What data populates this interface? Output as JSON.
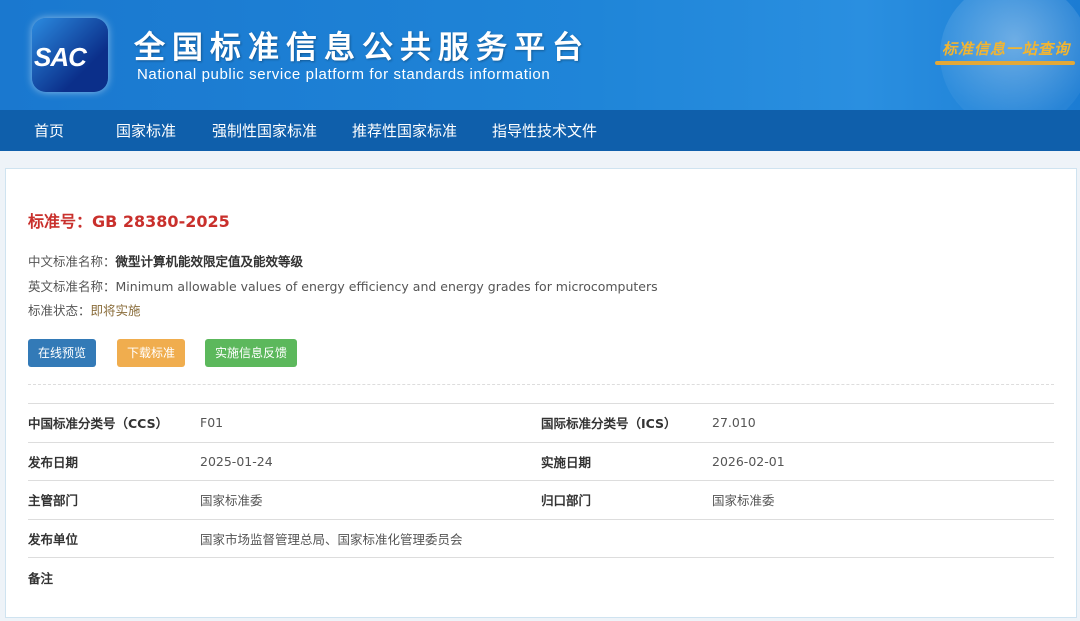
{
  "header": {
    "logo_text": "SAC",
    "title_cn": "全国标准信息公共服务平台",
    "title_en": "National public service platform  for standards information",
    "slogan": "标准信息一站查询"
  },
  "nav": [
    "首页",
    "国家标准",
    "强制性国家标准",
    "推荐性国家标准",
    "指导性技术文件"
  ],
  "standard": {
    "number": "标准号：GB 28380-2025",
    "cn_name_label": "中文标准名称：",
    "cn_name": "微型计算机能效限定值及能效等级",
    "en_name_label": "英文标准名称：",
    "en_name": "Minimum allowable values of energy efficiency and energy grades for microcomputers",
    "status_label": "标准状态：",
    "status": "即将实施"
  },
  "buttons": {
    "preview": "在线预览",
    "download": "下载标准",
    "feedback": "实施信息反馈"
  },
  "colors": {
    "preview": "#337ab7",
    "download": "#f0ad4e",
    "feedback": "#5cb85c"
  },
  "details": [
    [
      "中国标准分类号（CCS）",
      "F01",
      "国际标准分类号（ICS）",
      "27.010"
    ],
    [
      "发布日期",
      "2025-01-24",
      "实施日期",
      "2026-02-01"
    ],
    [
      "主管部门",
      "国家标准委",
      "归口部门",
      "国家标准委"
    ],
    [
      "发布单位",
      "国家市场监督管理总局、国家标准化管理委员会",
      "",
      ""
    ],
    [
      "备注",
      "",
      "",
      ""
    ]
  ]
}
